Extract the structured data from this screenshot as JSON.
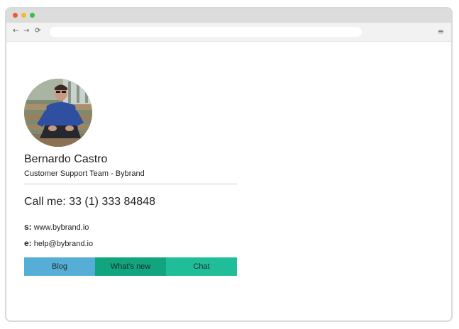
{
  "browser": {
    "nav": {
      "back_icon": "←",
      "forward_icon": "→",
      "reload_icon": "⟳",
      "menu_icon": "≡"
    },
    "address": ""
  },
  "signature": {
    "name": "Bernardo Castro",
    "role": "Customer Support Team - Bybrand",
    "phone": "Call me: 33 (1) 333 84848",
    "site_label": "s:",
    "site_value": "www.bybrand.io",
    "email_label": "e:",
    "email_value": "help@bybrand.io",
    "buttons": {
      "blog": "Blog",
      "whats_new": "What's new",
      "chat": "Chat"
    }
  },
  "colors": {
    "blog": "#56aed6",
    "whats_new": "#11a47f",
    "chat": "#1fbe98"
  }
}
